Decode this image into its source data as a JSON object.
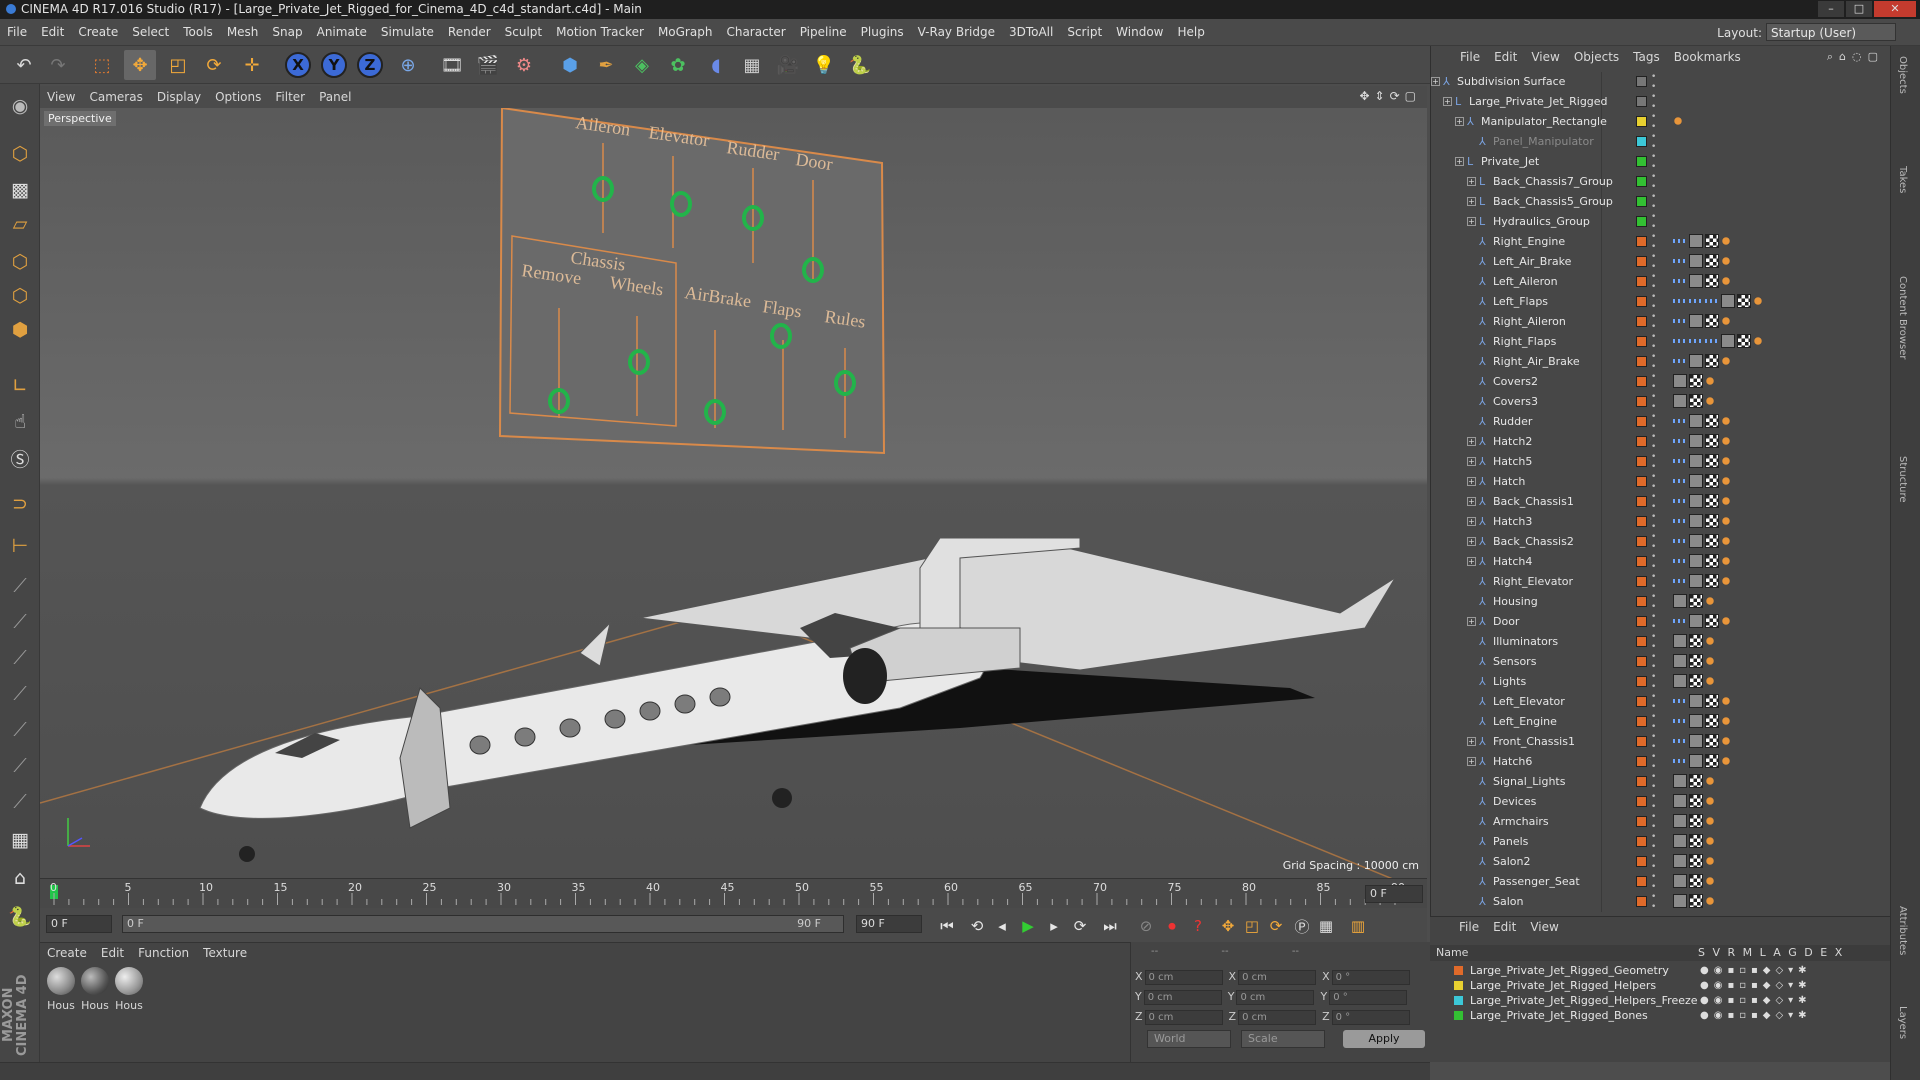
{
  "window": {
    "title": "CINEMA 4D R17.016 Studio (R17) - [Large_Private_Jet_Rigged_for_Cinema_4D_c4d_standart.c4d] - Main"
  },
  "menubar": {
    "items": [
      "File",
      "Edit",
      "Create",
      "Select",
      "Tools",
      "Mesh",
      "Snap",
      "Animate",
      "Simulate",
      "Render",
      "Sculpt",
      "Motion Tracker",
      "MoGraph",
      "Character",
      "Pipeline",
      "Plugins",
      "V-Ray Bridge",
      "3DToAll",
      "Script",
      "Window",
      "Help"
    ],
    "layout_label": "Layout:",
    "layout_value": "Startup (User)"
  },
  "toolbar": {
    "axis_x": "X",
    "axis_y": "Y",
    "axis_z": "Z"
  },
  "viewport": {
    "menu": [
      "View",
      "Cameras",
      "Display",
      "Options",
      "Filter",
      "Panel"
    ],
    "label": "Perspective",
    "grid_spacing": "Grid Spacing : 10000 cm",
    "panel_labels": [
      "Aileron",
      "Elevator",
      "Rudder",
      "Door",
      "Chassis",
      "Remove",
      "Wheels",
      "AirBrake",
      "Flaps",
      "Rules"
    ]
  },
  "timeline": {
    "ticks": [
      "0",
      "5",
      "10",
      "15",
      "20",
      "25",
      "30",
      "35",
      "40",
      "45",
      "50",
      "55",
      "60",
      "65",
      "70",
      "75",
      "80",
      "85",
      "90"
    ],
    "current_frame": "0 F",
    "start": "0 F",
    "range_start": "0 F",
    "range_end": "90 F",
    "end": "90 F",
    "end_field": "90 F"
  },
  "materials": {
    "menu": [
      "Create",
      "Edit",
      "Function",
      "Texture"
    ],
    "items": [
      "Hous",
      "Hous",
      "Hous"
    ]
  },
  "coords": {
    "rows": [
      {
        "a": "X",
        "v1": "0 cm",
        "b": "X",
        "v2": "0 cm",
        "c": "X",
        "v3": "0 °"
      },
      {
        "a": "Y",
        "v1": "0 cm",
        "b": "Y",
        "v2": "0 cm",
        "c": "Y",
        "v3": "0 °"
      },
      {
        "a": "Z",
        "v1": "0 cm",
        "b": "Z",
        "v2": "0 cm",
        "c": "Z",
        "v3": "0 °"
      }
    ],
    "header": [
      "--",
      "--",
      "--"
    ],
    "world": "World",
    "scale": "Scale",
    "apply": "Apply"
  },
  "objects": {
    "menu": [
      "File",
      "Edit",
      "View",
      "Objects",
      "Tags",
      "Bookmarks"
    ],
    "rows": [
      {
        "name": "Subdivision Surface",
        "depth": 0,
        "color": "#777",
        "tags": "none"
      },
      {
        "name": "Large_Private_Jet_Rigged",
        "depth": 1,
        "color": "#777",
        "tags": "none"
      },
      {
        "name": "Manipulator_Rectangle",
        "depth": 2,
        "color": "#e8d030",
        "tags": "or"
      },
      {
        "name": "Panel_Manipulator",
        "depth": 3,
        "color": "#3cc8d8",
        "tags": "none",
        "gray": true
      },
      {
        "name": "Private_Jet",
        "depth": 2,
        "color": "#33c033",
        "tags": "none"
      },
      {
        "name": "Back_Chassis7_Group",
        "depth": 3,
        "color": "#33c033",
        "tags": "none"
      },
      {
        "name": "Back_Chassis5_Group",
        "depth": 3,
        "color": "#33c033",
        "tags": "none"
      },
      {
        "name": "Hydraulics_Group",
        "depth": 3,
        "color": "#33c033",
        "tags": "none"
      },
      {
        "name": "Right_Engine",
        "depth": 3,
        "color": "#e06a2a",
        "tags": "full"
      },
      {
        "name": "Left_Air_Brake",
        "depth": 3,
        "color": "#e06a2a",
        "tags": "full"
      },
      {
        "name": "Left_Aileron",
        "depth": 3,
        "color": "#e06a2a",
        "tags": "full"
      },
      {
        "name": "Left_Flaps",
        "depth": 3,
        "color": "#e06a2a",
        "tags": "long"
      },
      {
        "name": "Right_Aileron",
        "depth": 3,
        "color": "#e06a2a",
        "tags": "full"
      },
      {
        "name": "Right_Flaps",
        "depth": 3,
        "color": "#e06a2a",
        "tags": "long"
      },
      {
        "name": "Right_Air_Brake",
        "depth": 3,
        "color": "#e06a2a",
        "tags": "full"
      },
      {
        "name": "Covers2",
        "depth": 3,
        "color": "#e06a2a",
        "tags": "short"
      },
      {
        "name": "Covers3",
        "depth": 3,
        "color": "#e06a2a",
        "tags": "short"
      },
      {
        "name": "Rudder",
        "depth": 3,
        "color": "#e06a2a",
        "tags": "full"
      },
      {
        "name": "Hatch2",
        "depth": 3,
        "color": "#e06a2a",
        "tags": "full"
      },
      {
        "name": "Hatch5",
        "depth": 3,
        "color": "#e06a2a",
        "tags": "full"
      },
      {
        "name": "Hatch",
        "depth": 3,
        "color": "#e06a2a",
        "tags": "full"
      },
      {
        "name": "Back_Chassis1",
        "depth": 3,
        "color": "#e06a2a",
        "tags": "full"
      },
      {
        "name": "Hatch3",
        "depth": 3,
        "color": "#e06a2a",
        "tags": "full"
      },
      {
        "name": "Back_Chassis2",
        "depth": 3,
        "color": "#e06a2a",
        "tags": "full"
      },
      {
        "name": "Hatch4",
        "depth": 3,
        "color": "#e06a2a",
        "tags": "full"
      },
      {
        "name": "Right_Elevator",
        "depth": 3,
        "color": "#e06a2a",
        "tags": "full"
      },
      {
        "name": "Housing",
        "depth": 3,
        "color": "#e06a2a",
        "tags": "short"
      },
      {
        "name": "Door",
        "depth": 3,
        "color": "#e06a2a",
        "tags": "full"
      },
      {
        "name": "Illuminators",
        "depth": 3,
        "color": "#e06a2a",
        "tags": "short"
      },
      {
        "name": "Sensors",
        "depth": 3,
        "color": "#e06a2a",
        "tags": "short"
      },
      {
        "name": "Lights",
        "depth": 3,
        "color": "#e06a2a",
        "tags": "short"
      },
      {
        "name": "Left_Elevator",
        "depth": 3,
        "color": "#e06a2a",
        "tags": "full"
      },
      {
        "name": "Left_Engine",
        "depth": 3,
        "color": "#e06a2a",
        "tags": "full"
      },
      {
        "name": "Front_Chassis1",
        "depth": 3,
        "color": "#e06a2a",
        "tags": "full"
      },
      {
        "name": "Hatch6",
        "depth": 3,
        "color": "#e06a2a",
        "tags": "full"
      },
      {
        "name": "Signal_Lights",
        "depth": 3,
        "color": "#e06a2a",
        "tags": "short"
      },
      {
        "name": "Devices",
        "depth": 3,
        "color": "#e06a2a",
        "tags": "short"
      },
      {
        "name": "Armchairs",
        "depth": 3,
        "color": "#e06a2a",
        "tags": "short"
      },
      {
        "name": "Panels",
        "depth": 3,
        "color": "#e06a2a",
        "tags": "short"
      },
      {
        "name": "Salon2",
        "depth": 3,
        "color": "#e06a2a",
        "tags": "short"
      },
      {
        "name": "Passenger_Seat",
        "depth": 3,
        "color": "#e06a2a",
        "tags": "short"
      },
      {
        "name": "Salon",
        "depth": 3,
        "color": "#e06a2a",
        "tags": "short"
      }
    ]
  },
  "layers": {
    "menu": [
      "File",
      "Edit",
      "View"
    ],
    "header_name": "Name",
    "header_cols": "S V R M L A G D E X",
    "rows": [
      {
        "name": "Large_Private_Jet_Rigged_Geometry",
        "color": "#e06a2a"
      },
      {
        "name": "Large_Private_Jet_Rigged_Helpers",
        "color": "#e8d030"
      },
      {
        "name": "Large_Private_Jet_Rigged_Helpers_Freeze",
        "color": "#3cc8d8"
      },
      {
        "name": "Large_Private_Jet_Rigged_Bones",
        "color": "#33c033"
      }
    ]
  },
  "right_tabs": [
    "Objects",
    "Takes",
    "Content Browser",
    "Structure",
    "Attributes",
    "Layers"
  ],
  "branding": "MAXON CINEMA 4D"
}
